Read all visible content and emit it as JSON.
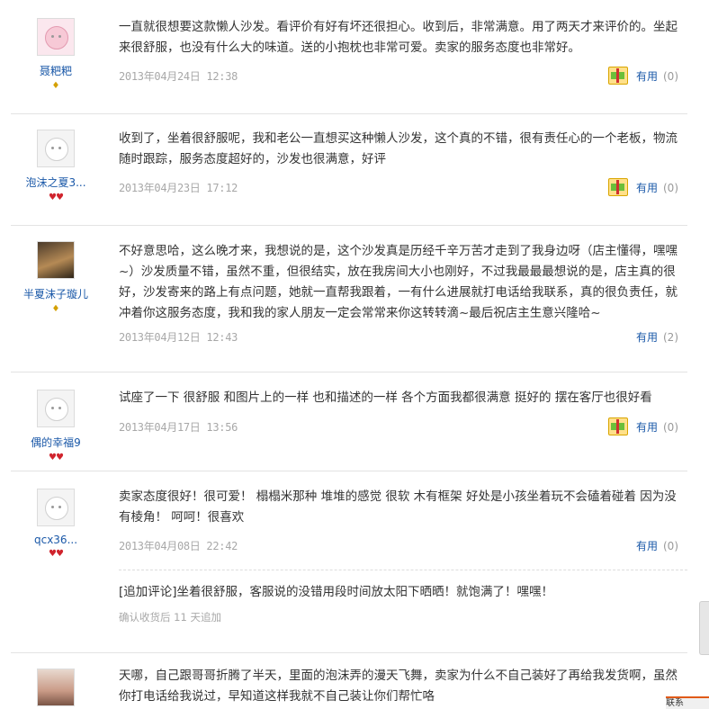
{
  "reviews": [
    {
      "user": "聂粑粑",
      "rank": "♦",
      "text": "一直就很想要这款懒人沙发。看评价有好有坏还很担心。收到后，非常满意。用了两天才来评价的。坐起来很舒服，也没有什么大的味道。送的小抱枕也非常可爱。卖家的服务态度也非常好。",
      "date": "2013年04月24日 12:38",
      "useful_label": "有用",
      "useful_count": "(0)"
    },
    {
      "user": "泡沫之夏3...",
      "rank": "♥♥",
      "text": "收到了，坐着很舒服呢，我和老公一直想买这种懒人沙发，这个真的不错，很有责任心的一个老板，物流随时跟踪，服务态度超好的，沙发也很满意，好评",
      "date": "2013年04月23日 17:12",
      "useful_label": "有用",
      "useful_count": "(0)"
    },
    {
      "user": "半夏沫子璇儿",
      "rank": "♦",
      "text": "不好意思哈，这么晚才来，我想说的是，这个沙发真是历经千辛万苦才走到了我身边呀（店主懂得，嘿嘿~）沙发质量不错，虽然不重，但很结实，放在我房间大小也刚好，不过我最最最想说的是，店主真的很好，沙发寄来的路上有点问题，她就一直帮我跟着，一有什么进展就打电话给我联系，真的很负责任，就冲着你这服务态度，我和我的家人朋友一定会常常来你这转转滴~最后祝店主生意兴隆哈~",
      "date": "2013年04月12日 12:43",
      "useful_label": "有用",
      "useful_count": "(2)"
    },
    {
      "user": "偶的幸福9",
      "rank": "♥♥",
      "text": "试座了一下 很舒服 和图片上的一样 也和描述的一样 各个方面我都很满意 挺好的 摆在客厅也很好看",
      "date": "2013年04月17日 13:56",
      "useful_label": "有用",
      "useful_count": "(0)"
    },
    {
      "user": "qcx36...",
      "rank": "♥♥",
      "text": "卖家态度很好！很可爱！ 榻榻米那种 堆堆的感觉 很软 木有框架 好处是小孩坐着玩不会磕着碰着 因为没有棱角！ 呵呵！很喜欢",
      "date": "2013年04月08日 22:42",
      "useful_label": "有用",
      "useful_count": "(0)",
      "append_text": "[追加评论]坐着很舒服，客服说的没错用段时间放太阳下晒晒！就饱满了！嘿嘿！",
      "append_meta": "确认收货后 11 天追加"
    },
    {
      "user": "",
      "rank": "",
      "text": "天哪，自己跟哥哥折腾了半天，里面的泡沫弄的漫天飞舞，卖家为什么不自己装好了再给我发货啊，虽然你打电话给我说过，早知道这样我就不自己装让你们帮忙咯"
    }
  ],
  "bottom_bar_text": "联系"
}
